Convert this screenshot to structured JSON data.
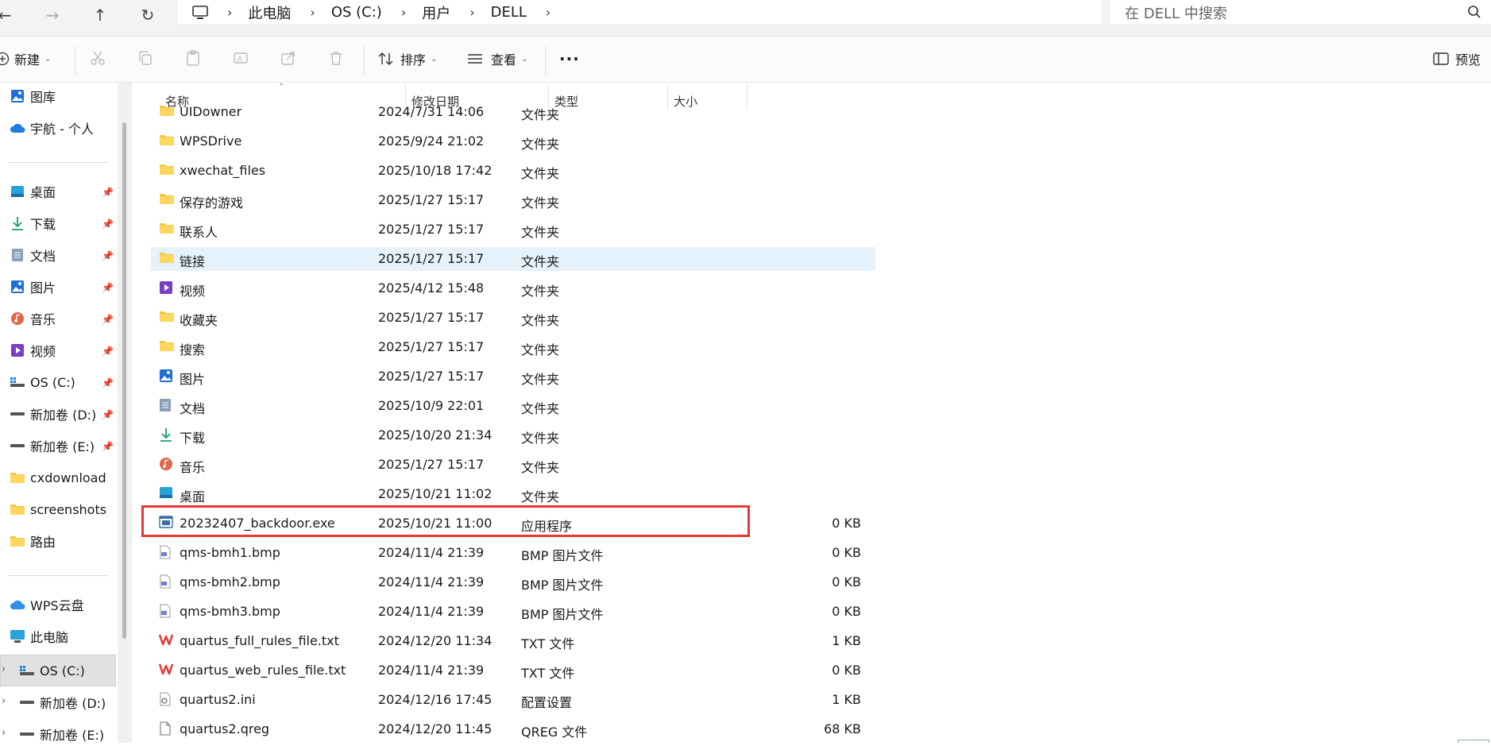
{
  "window": {
    "breadcrumbs": [
      "此电脑",
      "OS (C:)",
      "用户",
      "DELL"
    ],
    "search_placeholder": "在 DELL 中搜索"
  },
  "toolbar": {
    "new_label": "新建",
    "sort_label": "排序",
    "view_label": "查看",
    "more_label": "···",
    "preview_label": "预览"
  },
  "sidebar": {
    "top_items": [
      {
        "label": "图库",
        "icon": "gallery-icon"
      },
      {
        "label": "宇航 - 个人",
        "icon": "onedrive-icon"
      }
    ],
    "pinned_items": [
      {
        "label": "桌面",
        "icon": "desktop-icon",
        "pinned": true
      },
      {
        "label": "下载",
        "icon": "download-icon",
        "pinned": true
      },
      {
        "label": "文档",
        "icon": "document-icon",
        "pinned": true
      },
      {
        "label": "图片",
        "icon": "pictures-icon",
        "pinned": true
      },
      {
        "label": "音乐",
        "icon": "music-icon",
        "pinned": true
      },
      {
        "label": "视频",
        "icon": "videos-icon",
        "pinned": true
      },
      {
        "label": "OS (C:)",
        "icon": "drive-c-icon",
        "pinned": true
      },
      {
        "label": "新加卷 (D:)",
        "icon": "drive-icon",
        "pinned": true
      },
      {
        "label": "新加卷 (E:)",
        "icon": "drive-icon",
        "pinned": true
      },
      {
        "label": "cxdownload",
        "icon": "folder-icon",
        "pinned": false
      },
      {
        "label": "screenshots",
        "icon": "folder-icon",
        "pinned": false
      },
      {
        "label": "路由",
        "icon": "folder-icon",
        "pinned": false
      }
    ],
    "bottom_items": [
      {
        "label": "WPS云盘",
        "icon": "cloud-icon"
      },
      {
        "label": "此电脑",
        "icon": "this-pc-icon"
      },
      {
        "label": "OS (C:)",
        "icon": "drive-c-icon",
        "selected": true
      },
      {
        "label": "新加卷 (D:)",
        "icon": "drive-icon"
      },
      {
        "label": "新加卷 (E:)",
        "icon": "drive-icon"
      }
    ]
  },
  "columns": {
    "name": "名称",
    "date": "修改日期",
    "type": "类型",
    "size": "大小"
  },
  "files": [
    {
      "name": "UIDowner",
      "date": "2024/7/31 14:06",
      "type": "文件夹",
      "size": "",
      "icon": "folder-icon"
    },
    {
      "name": "WPSDrive",
      "date": "2025/9/24 21:02",
      "type": "文件夹",
      "size": "",
      "icon": "folder-icon"
    },
    {
      "name": "xwechat_files",
      "date": "2025/10/18 17:42",
      "type": "文件夹",
      "size": "",
      "icon": "folder-icon"
    },
    {
      "name": "保存的游戏",
      "date": "2025/1/27 15:17",
      "type": "文件夹",
      "size": "",
      "icon": "folder-icon"
    },
    {
      "name": "联系人",
      "date": "2025/1/27 15:17",
      "type": "文件夹",
      "size": "",
      "icon": "folder-icon"
    },
    {
      "name": "链接",
      "date": "2025/1/27 15:17",
      "type": "文件夹",
      "size": "",
      "icon": "folder-icon",
      "highlight": true
    },
    {
      "name": "视频",
      "date": "2025/4/12 15:48",
      "type": "文件夹",
      "size": "",
      "icon": "videos-icon"
    },
    {
      "name": "收藏夹",
      "date": "2025/1/27 15:17",
      "type": "文件夹",
      "size": "",
      "icon": "folder-icon"
    },
    {
      "name": "搜索",
      "date": "2025/1/27 15:17",
      "type": "文件夹",
      "size": "",
      "icon": "folder-icon"
    },
    {
      "name": "图片",
      "date": "2025/1/27 15:17",
      "type": "文件夹",
      "size": "",
      "icon": "pictures-icon"
    },
    {
      "name": "文档",
      "date": "2025/10/9 22:01",
      "type": "文件夹",
      "size": "",
      "icon": "document-icon"
    },
    {
      "name": "下载",
      "date": "2025/10/20 21:34",
      "type": "文件夹",
      "size": "",
      "icon": "download-icon"
    },
    {
      "name": "音乐",
      "date": "2025/1/27 15:17",
      "type": "文件夹",
      "size": "",
      "icon": "music-icon"
    },
    {
      "name": "桌面",
      "date": "2025/10/21 11:02",
      "type": "文件夹",
      "size": "",
      "icon": "desktop-icon"
    },
    {
      "name": "20232407_backdoor.exe",
      "date": "2025/10/21 11:00",
      "type": "应用程序",
      "size": "0 KB",
      "icon": "exe-icon",
      "boxed": true
    },
    {
      "name": "qms-bmh1.bmp",
      "date": "2024/11/4 21:39",
      "type": "BMP 图片文件",
      "size": "0 KB",
      "icon": "bmp-icon"
    },
    {
      "name": "qms-bmh2.bmp",
      "date": "2024/11/4 21:39",
      "type": "BMP 图片文件",
      "size": "0 KB",
      "icon": "bmp-icon"
    },
    {
      "name": "qms-bmh3.bmp",
      "date": "2024/11/4 21:39",
      "type": "BMP 图片文件",
      "size": "0 KB",
      "icon": "bmp-icon"
    },
    {
      "name": "quartus_full_rules_file.txt",
      "date": "2024/12/20 11:34",
      "type": "TXT 文件",
      "size": "1 KB",
      "icon": "wps-text-icon"
    },
    {
      "name": "quartus_web_rules_file.txt",
      "date": "2024/11/4 21:39",
      "type": "TXT 文件",
      "size": "0 KB",
      "icon": "wps-text-icon"
    },
    {
      "name": "quartus2.ini",
      "date": "2024/12/16 17:45",
      "type": "配置设置",
      "size": "1 KB",
      "icon": "ini-icon"
    },
    {
      "name": "quartus2.qreg",
      "date": "2024/12/20 11:45",
      "type": "QREG 文件",
      "size": "68 KB",
      "icon": "file-icon"
    }
  ]
}
